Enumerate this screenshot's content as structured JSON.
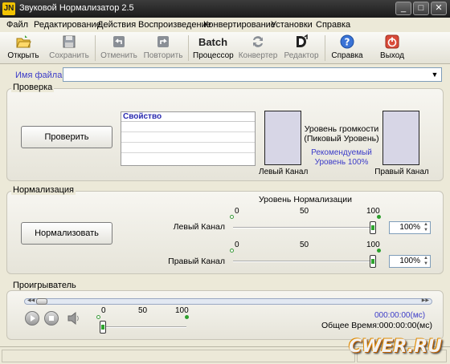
{
  "window": {
    "title": "Звуковой Нормализатор 2.5",
    "app_badge": "JN"
  },
  "menu": [
    "Файл",
    "Редактирование",
    "Действия",
    "Воспроизведение",
    "Конвертирование",
    "Установки",
    "Справка"
  ],
  "toolbar": {
    "open": "Открыть",
    "save": "Сохранить",
    "undo": "Отменить",
    "redo": "Повторить",
    "batch_top": "Batch",
    "batch": "Процессор",
    "convert": "Конвертер",
    "editor": "Редактор",
    "help": "Справка",
    "exit": "Выход"
  },
  "file": {
    "label": "Имя файла:",
    "value": ""
  },
  "check": {
    "group": "Проверка",
    "button": "Проверить",
    "table_header": "Свойство",
    "table_rows": [
      "",
      "",
      "",
      ""
    ],
    "level_title_1": "Уровень громкости",
    "level_title_2": "(Пиковый Уровень)",
    "recommended_1": "Рекомендуемый",
    "recommended_2": "Уровень 100%",
    "left_channel": "Левый Канал",
    "right_channel": "Правый Канал",
    "left_level": 0,
    "right_level": 0
  },
  "normalize": {
    "group": "Нормализация",
    "button": "Нормализовать",
    "title": "Уровень Нормализации",
    "scale": [
      "0",
      "50",
      "100"
    ],
    "left_label": "Левый Канал",
    "right_label": "Правый Канал",
    "left_value": "100%",
    "right_value": "100%",
    "left_level": 100,
    "right_level": 100
  },
  "player": {
    "group": "Проигрыватель",
    "scale": [
      "0",
      "50",
      "100"
    ],
    "volume": 0,
    "position_time": "000:00:00(мс)",
    "total_time": "Общее Время:000:00:00(мс)",
    "seek_left": "◀◀",
    "seek_right": "▶▶",
    "seek_position": 0
  },
  "watermark": "CWER.RU",
  "colors": {
    "accent_blue": "#3b3bc8",
    "slider_green": "#2ea42e",
    "meter_fill": "#d7d6e6"
  }
}
